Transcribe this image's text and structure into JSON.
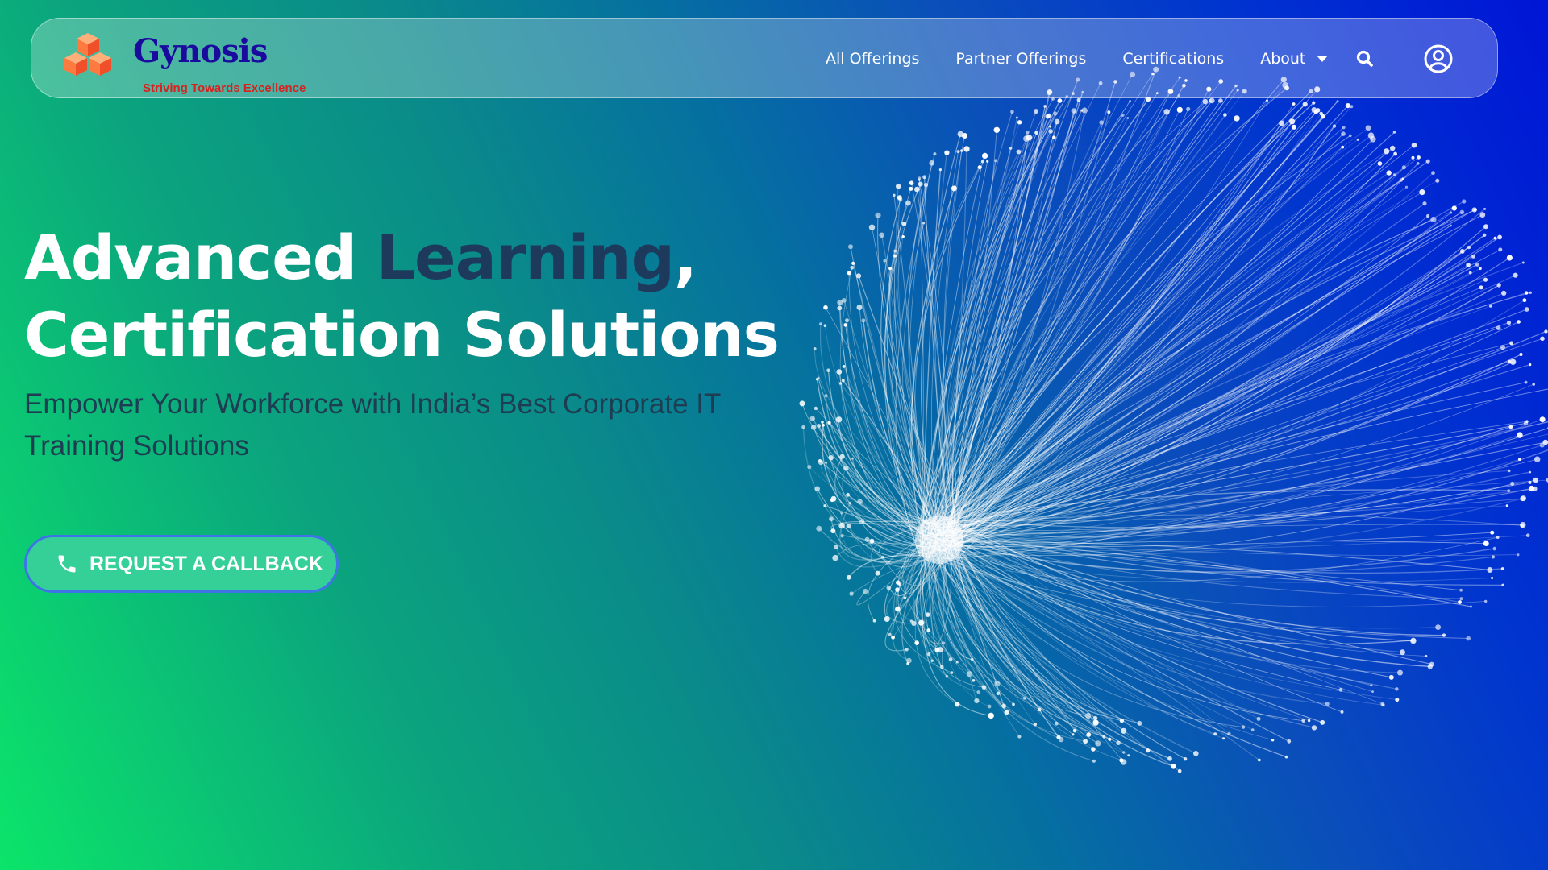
{
  "brand": {
    "name": "Gynosis",
    "tagline": "Striving Towards Excellence"
  },
  "nav": {
    "items": [
      "All Offerings",
      "Partner Offerings",
      "Certifications"
    ],
    "about_label": "About"
  },
  "icons": {
    "logo": "stacked-cubes-icon",
    "search": "search-icon",
    "account": "user-circle-icon",
    "phone": "phone-icon",
    "dropdown": "caret-down-icon"
  },
  "hero": {
    "title_part1": "Advanced ",
    "title_highlight": "Learning",
    "title_comma": ",",
    "title_line2": "Certification Solutions",
    "subtitle": "Empower Your Workforce with India’s Best Corporate IT Training Solutions",
    "cta_label": "REQUEST A CALLBACK"
  },
  "colors": {
    "brand_name": "#1a0a9e",
    "tagline": "#d8211e",
    "title_highlight": "#1d3a5c",
    "cta_background": "#35cf98",
    "cta_border": "#3f74e8",
    "gradient_start": "#0be46a",
    "gradient_end": "#0015d6"
  }
}
